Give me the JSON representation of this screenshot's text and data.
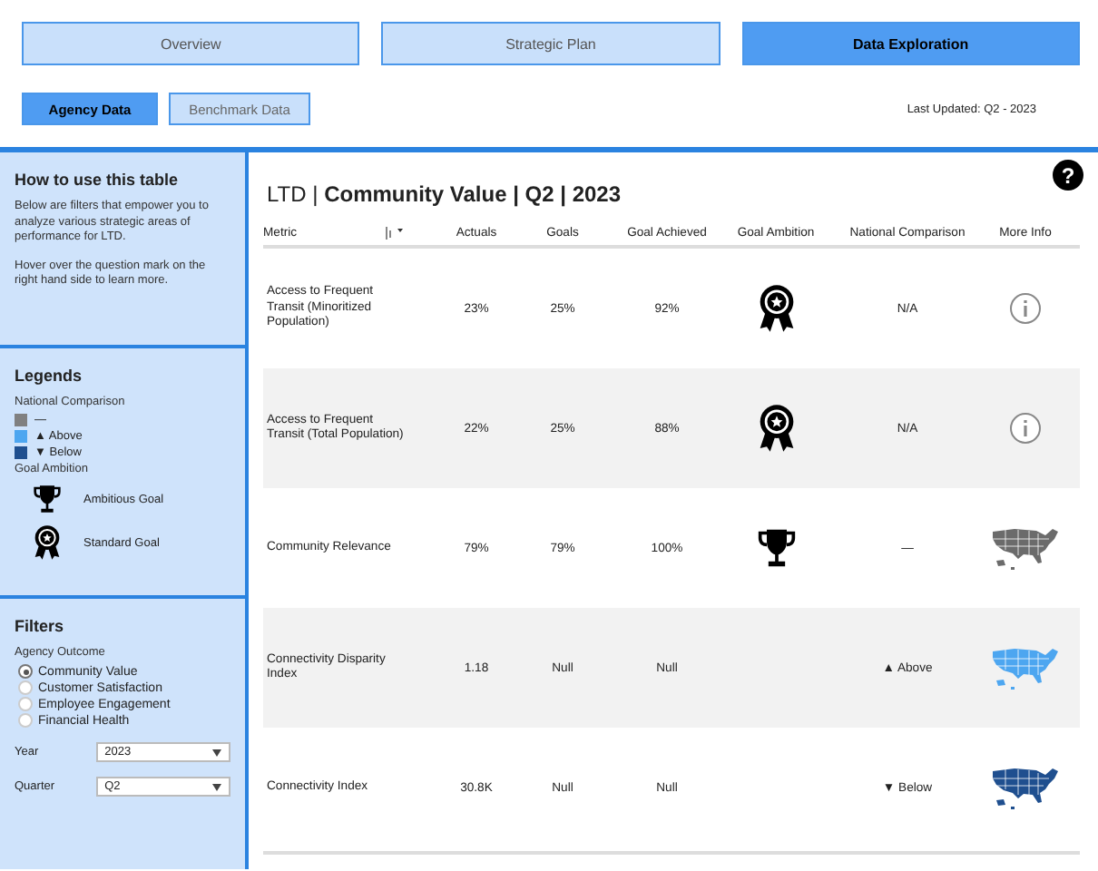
{
  "nav_tabs": [
    {
      "label": "Overview",
      "selected": false
    },
    {
      "label": "Strategic Plan",
      "selected": false
    },
    {
      "label": "Data Exploration",
      "selected": true
    }
  ],
  "sub_tabs": [
    {
      "label": "Agency Data",
      "selected": true
    },
    {
      "label": "Benchmark Data",
      "selected": false
    }
  ],
  "last_updated": "Last Updated: Q2 - 2023",
  "sidebar": {
    "how_to": {
      "title": "How to use this table",
      "paragraphs": [
        "Below are filters that empower you to analyze various strategic areas of performance for LTD.",
        "Hover over the question mark on the right hand side to learn more."
      ]
    },
    "legends": {
      "title": "Legends",
      "national_comparison": {
        "label": "National Comparison",
        "items": [
          {
            "color": "#808080",
            "text": "—"
          },
          {
            "color": "#4da6f0",
            "text": "▲ Above"
          },
          {
            "color": "#1f4f8f",
            "text": "▼ Below"
          }
        ]
      },
      "goal_ambition": {
        "label": "Goal Ambition",
        "items": [
          {
            "kind": "trophy",
            "text": "Ambitious Goal"
          },
          {
            "kind": "ribbon",
            "text": "Standard Goal"
          }
        ]
      }
    },
    "filters": {
      "title": "Filters",
      "agency_outcome": {
        "label": "Agency Outcome",
        "options": [
          {
            "label": "Community Value",
            "selected": true
          },
          {
            "label": "Customer Satisfaction",
            "selected": false
          },
          {
            "label": "Employee Engagement",
            "selected": false
          },
          {
            "label": "Financial Health",
            "selected": false
          }
        ]
      },
      "year": {
        "label": "Year",
        "value": "2023"
      },
      "quarter": {
        "label": "Quarter",
        "value": "Q2"
      }
    }
  },
  "table": {
    "title": "LTD | **Community Value | Q2 | 2023**",
    "help": "?",
    "columns": [
      "Metric",
      "Actuals",
      "Goals",
      "Goal Achieved",
      "Goal Ambition",
      "National Comparison",
      "More Info"
    ],
    "rows": [
      {
        "metric": "Access to Frequent Transit (Minoritized Population)",
        "actuals": "23%",
        "goals": "25%",
        "goal_achieved": "92%",
        "goal_ambition": {
          "kind": "ribbon"
        },
        "national_comparison": "N/A",
        "more_info": {
          "kind": "info"
        }
      },
      {
        "metric": "Access to Frequent Transit (Total Population)",
        "actuals": "22%",
        "goals": "25%",
        "goal_achieved": "88%",
        "goal_ambition": {
          "kind": "ribbon"
        },
        "national_comparison": "N/A",
        "more_info": {
          "kind": "info"
        }
      },
      {
        "metric": "Community Relevance",
        "actuals": "79%",
        "goals": "79%",
        "goal_achieved": "100%",
        "goal_ambition": {
          "kind": "trophy"
        },
        "national_comparison": "—",
        "more_info": {
          "kind": "map",
          "color": "#6b6b6b"
        }
      },
      {
        "metric": "Connectivity Disparity Index",
        "actuals": "1.18",
        "goals": "Null",
        "goal_achieved": "Null",
        "national_comparison": "▲ Above",
        "more_info": {
          "kind": "map",
          "color": "#4da6f0"
        }
      },
      {
        "metric": "Connectivity Index",
        "actuals": "30.8K",
        "goals": "Null",
        "goal_achieved": "Null",
        "national_comparison": "▼ Below",
        "more_info": {
          "kind": "map",
          "color": "#1f4f8f"
        }
      }
    ]
  }
}
